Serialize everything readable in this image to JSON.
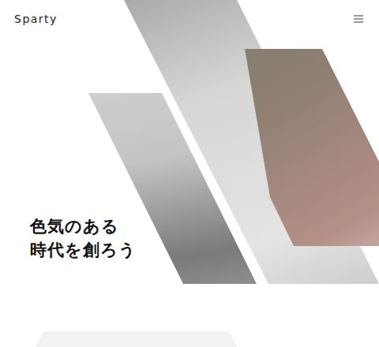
{
  "header": {
    "logo": "Sparty"
  },
  "hero": {
    "headline": [
      "色気のある",
      "時代を創ろう"
    ]
  }
}
